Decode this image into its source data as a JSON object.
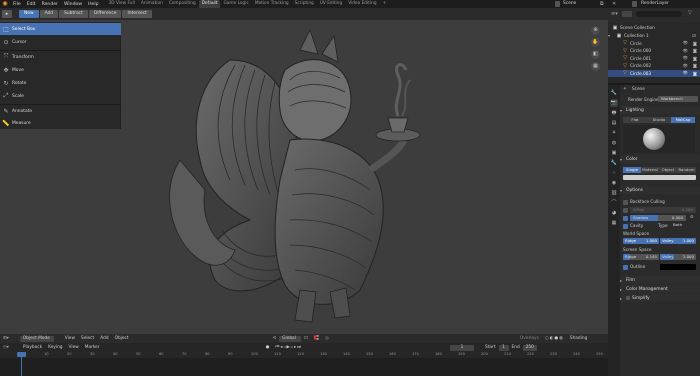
{
  "menubar": {
    "menus": [
      "File",
      "Edit",
      "Render",
      "Window",
      "Help"
    ],
    "workspaces": [
      "3D View Full",
      "Animation",
      "Compositing",
      "Default",
      "Game Logic",
      "Motion Tracking",
      "Scripting",
      "UV Editing",
      "Video Editing"
    ],
    "active_workspace": "Default",
    "add_tab": "+",
    "scene_label": "Scene",
    "renderlayer_label": "RenderLayer"
  },
  "tool_header": {
    "buttons": [
      "New",
      "Add",
      "Subtract",
      "Difference",
      "Intersect"
    ],
    "active": "New"
  },
  "toolbar": {
    "tools": [
      {
        "label": "Select Box",
        "icon": "select-box-icon",
        "active": true
      },
      {
        "label": "Cursor",
        "icon": "cursor-icon",
        "active": false
      },
      {
        "label": "Transform",
        "icon": "transform-icon",
        "active": false
      },
      {
        "label": "Move",
        "icon": "move-icon",
        "active": false
      },
      {
        "label": "Rotate",
        "icon": "rotate-icon",
        "active": false
      },
      {
        "label": "Scale",
        "icon": "scale-icon",
        "active": false
      },
      {
        "label": "Annotate",
        "icon": "annotate-icon",
        "active": false
      },
      {
        "label": "Measure",
        "icon": "measure-icon",
        "active": false
      }
    ]
  },
  "outliner": {
    "rows": [
      {
        "label": "Scene Collection",
        "selected": false,
        "icon": "collection-icon"
      },
      {
        "label": "Collection 1",
        "selected": false,
        "icon": "collection-icon"
      },
      {
        "label": "Circle",
        "selected": false,
        "icon": "curve-icon"
      },
      {
        "label": "Circle.000",
        "selected": false,
        "icon": "curve-icon"
      },
      {
        "label": "Circle.001",
        "selected": false,
        "icon": "curve-icon"
      },
      {
        "label": "Circle.002",
        "selected": false,
        "icon": "curve-icon"
      },
      {
        "label": "Circle.003",
        "selected": true,
        "icon": "curve-icon"
      }
    ]
  },
  "properties": {
    "scene_name": "Scene",
    "render_engine_label": "Render Engine",
    "render_engine_value": "Workbench",
    "lighting": {
      "title": "Lighting",
      "modes": [
        "Flat",
        "Studio",
        "MatCap"
      ],
      "active": "MatCap"
    },
    "color": {
      "title": "Color",
      "modes": [
        "Single",
        "Material",
        "Object",
        "Random"
      ],
      "active": "Single"
    },
    "options": {
      "title": "Options",
      "backface_label": "Backface Culling",
      "xray_label": "X-Ray",
      "xray_value": "0.500",
      "shadow_label": "Shadow",
      "shadow_value": "0.500",
      "cavity_label": "Cavity",
      "cavity_type_label": "Type",
      "cavity_type_value": "Both",
      "world_space_label": "World Space",
      "ws_ridge_label": "Ridge",
      "ws_ridge_value": "1.000",
      "ws_valley_label": "Valley",
      "ws_valley_value": "1.000",
      "screen_space_label": "Screen Space",
      "ss_ridge_label": "Ridge",
      "ss_ridge_value": "0.145",
      "ss_valley_label": "Valley",
      "ss_valley_value": "2.000",
      "outline_label": "Outline"
    },
    "film_title": "Film",
    "color_management_title": "Color Management",
    "simplify_title": "Simplify"
  },
  "viewport_header": {
    "mode": "Object Mode",
    "menus": [
      "View",
      "Select",
      "Add",
      "Object"
    ],
    "orientation": "Global",
    "overlays": "Overlays",
    "shading": "Shading"
  },
  "timeline_header": {
    "items": [
      "Playback",
      "Keying",
      "View",
      "Marker"
    ],
    "current_frame": "1",
    "start_label": "Start",
    "start_value": "1",
    "end_label": "End",
    "end_value": "250"
  },
  "timeline": {
    "ticks": [
      "0",
      "10",
      "20",
      "30",
      "40",
      "50",
      "60",
      "70",
      "80",
      "90",
      "100",
      "110",
      "120",
      "130",
      "140",
      "150",
      "160",
      "170",
      "180",
      "190",
      "200",
      "210",
      "220",
      "230",
      "240",
      "250"
    ]
  },
  "colors": {
    "accent": "#4772b3",
    "viewport_bg": "#3d3d3d",
    "panel_bg": "#2b2b2b",
    "selection_orange": "#ff9f2b"
  }
}
